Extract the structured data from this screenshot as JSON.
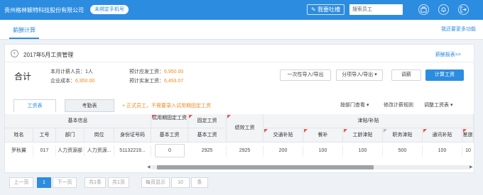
{
  "topbar": {
    "company": "贵州格林颖特科技股份有限公司",
    "bind_phone": "未绑定手机号",
    "feedback": "我要吐槽",
    "search_placeholder": "搜索员工"
  },
  "tabs": {
    "salary_calc": "薪酬计算",
    "more_features": "我还要更多功能"
  },
  "card": {
    "back_glyph": "‹",
    "title": "2017年5月工资管理",
    "report_link": "薪酬报表>>",
    "total_label": "合计",
    "stats": {
      "headcount_label": "本月计薪人员：",
      "headcount_value": "1人",
      "cost_label": "企业成本：",
      "cost_value": "6,950.00",
      "payable_label": "预计应发工资：",
      "payable_value": "6,950.00",
      "actual_label": "预计实发工资：",
      "actual_value": "6,493.07"
    },
    "buttons": {
      "import_once": "一次性导入/导出",
      "import_split": "分项导入/导出",
      "adjust": "调薪",
      "calculate": "计算工资"
    }
  },
  "subtabs": {
    "salary_table": "工资表",
    "attendance_table": "考勤表",
    "notice": "+ 正式员工，不需要录入试用期固定工资",
    "view_by_dept": "按部门查看",
    "modify_rules": "修改计薪规则",
    "adjust_table": "调整工资表"
  },
  "table": {
    "groups": {
      "basic_info": "基本信息",
      "probation_fixed": "试用期固定工资",
      "fixed_salary": "固定工资",
      "allowance": "津贴/补贴"
    },
    "headers": {
      "name": "姓名",
      "emp_no": "工号",
      "dept": "部门",
      "position": "岗位",
      "id_no": "身份证号码",
      "probation_base": "基本工资",
      "base_salary": "基本工资",
      "performance": "绩效工资",
      "transport": "交通补贴",
      "meal": "餐补",
      "seniority": "工龄津贴",
      "job_allowance": "职务津贴",
      "comm": "通讯补贴",
      "last": "差旅"
    },
    "rows": [
      {
        "name": "罗秋翼",
        "emp_no": "017",
        "dept": "人力资源部",
        "position": "人力资源...",
        "id_no": "51132219...",
        "probation_base": "0",
        "base_salary": "2925",
        "performance": "2925",
        "transport": "200",
        "meal": "100",
        "seniority": "100",
        "job_allowance": "500",
        "comm": "100",
        "last": "10"
      }
    ]
  },
  "pager": {
    "prev": "上一页",
    "current": "1",
    "next": "下一页",
    "total_items": "共1条",
    "total_pages": "共1页",
    "per_page_label": "每页显示",
    "per_page_value": "10",
    "unit": "条"
  },
  "colors": {
    "brand": "#2c8ce0",
    "accent": "#f08a24",
    "marker": "#e8544e"
  }
}
